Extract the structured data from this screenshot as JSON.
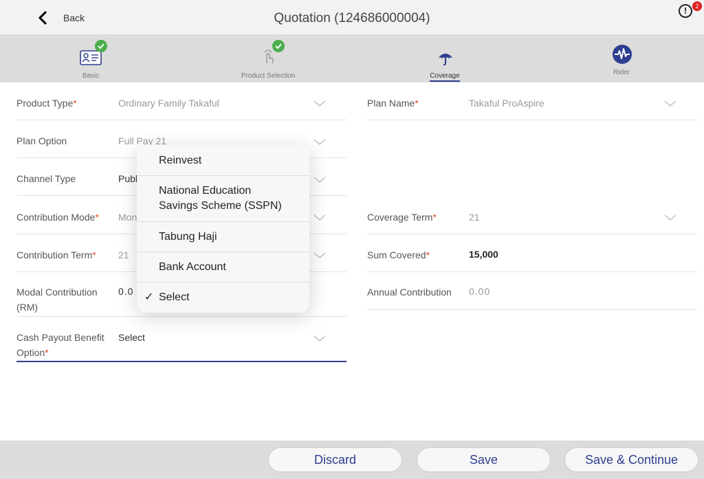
{
  "header": {
    "back_label": "Back",
    "title": "Quotation (124686000004)",
    "alert_count": "2"
  },
  "steps": [
    {
      "label": "Basic",
      "completed": true
    },
    {
      "label": "Product Selection",
      "completed": true
    },
    {
      "label": "Coverage",
      "active": true
    },
    {
      "label": "Rider"
    }
  ],
  "form_left": {
    "product_type": {
      "label": "Product Type",
      "value": "Ordinary Family Takaful"
    },
    "plan_option": {
      "label": "Plan Option",
      "value": "Full Pay 21"
    },
    "channel_type": {
      "label": "Channel Type",
      "value": "Publ"
    },
    "contribution_mode": {
      "label": "Contribution Mode",
      "value": "Mon"
    },
    "contribution_term": {
      "label": "Contribution Term",
      "value": "21"
    },
    "modal_contribution": {
      "label_line1": "Modal Contribution",
      "label_line2": "(RM)",
      "value": "0.0"
    },
    "cash_payout": {
      "label_line1": "Cash Payout Benefit",
      "label_line2": "Option",
      "value": "Select"
    }
  },
  "form_right": {
    "plan_name": {
      "label": "Plan Name",
      "value": "Takaful ProAspire"
    },
    "coverage_term": {
      "label": "Coverage Term",
      "value": "21"
    },
    "sum_covered": {
      "label": "Sum Covered",
      "value": "15,000"
    },
    "annual_contribution": {
      "label": "Annual Contribution",
      "value": "0.00"
    }
  },
  "required_mark": "*",
  "dropdown": {
    "options": [
      {
        "line1": "Reinvest"
      },
      {
        "line1": "National Education",
        "line2": "Savings Scheme (SSPN)"
      },
      {
        "line1": "Tabung Haji"
      },
      {
        "line1": "Bank Account"
      },
      {
        "line1": "Select",
        "selected": true
      }
    ],
    "check_glyph": "✓"
  },
  "footer": {
    "discard": "Discard",
    "save": "Save",
    "save_continue": "Save & Continue"
  },
  "colors": {
    "accent": "#2c3e8f",
    "required": "#e04a1f",
    "check": "#4cae4c",
    "badge": "#e02020"
  }
}
